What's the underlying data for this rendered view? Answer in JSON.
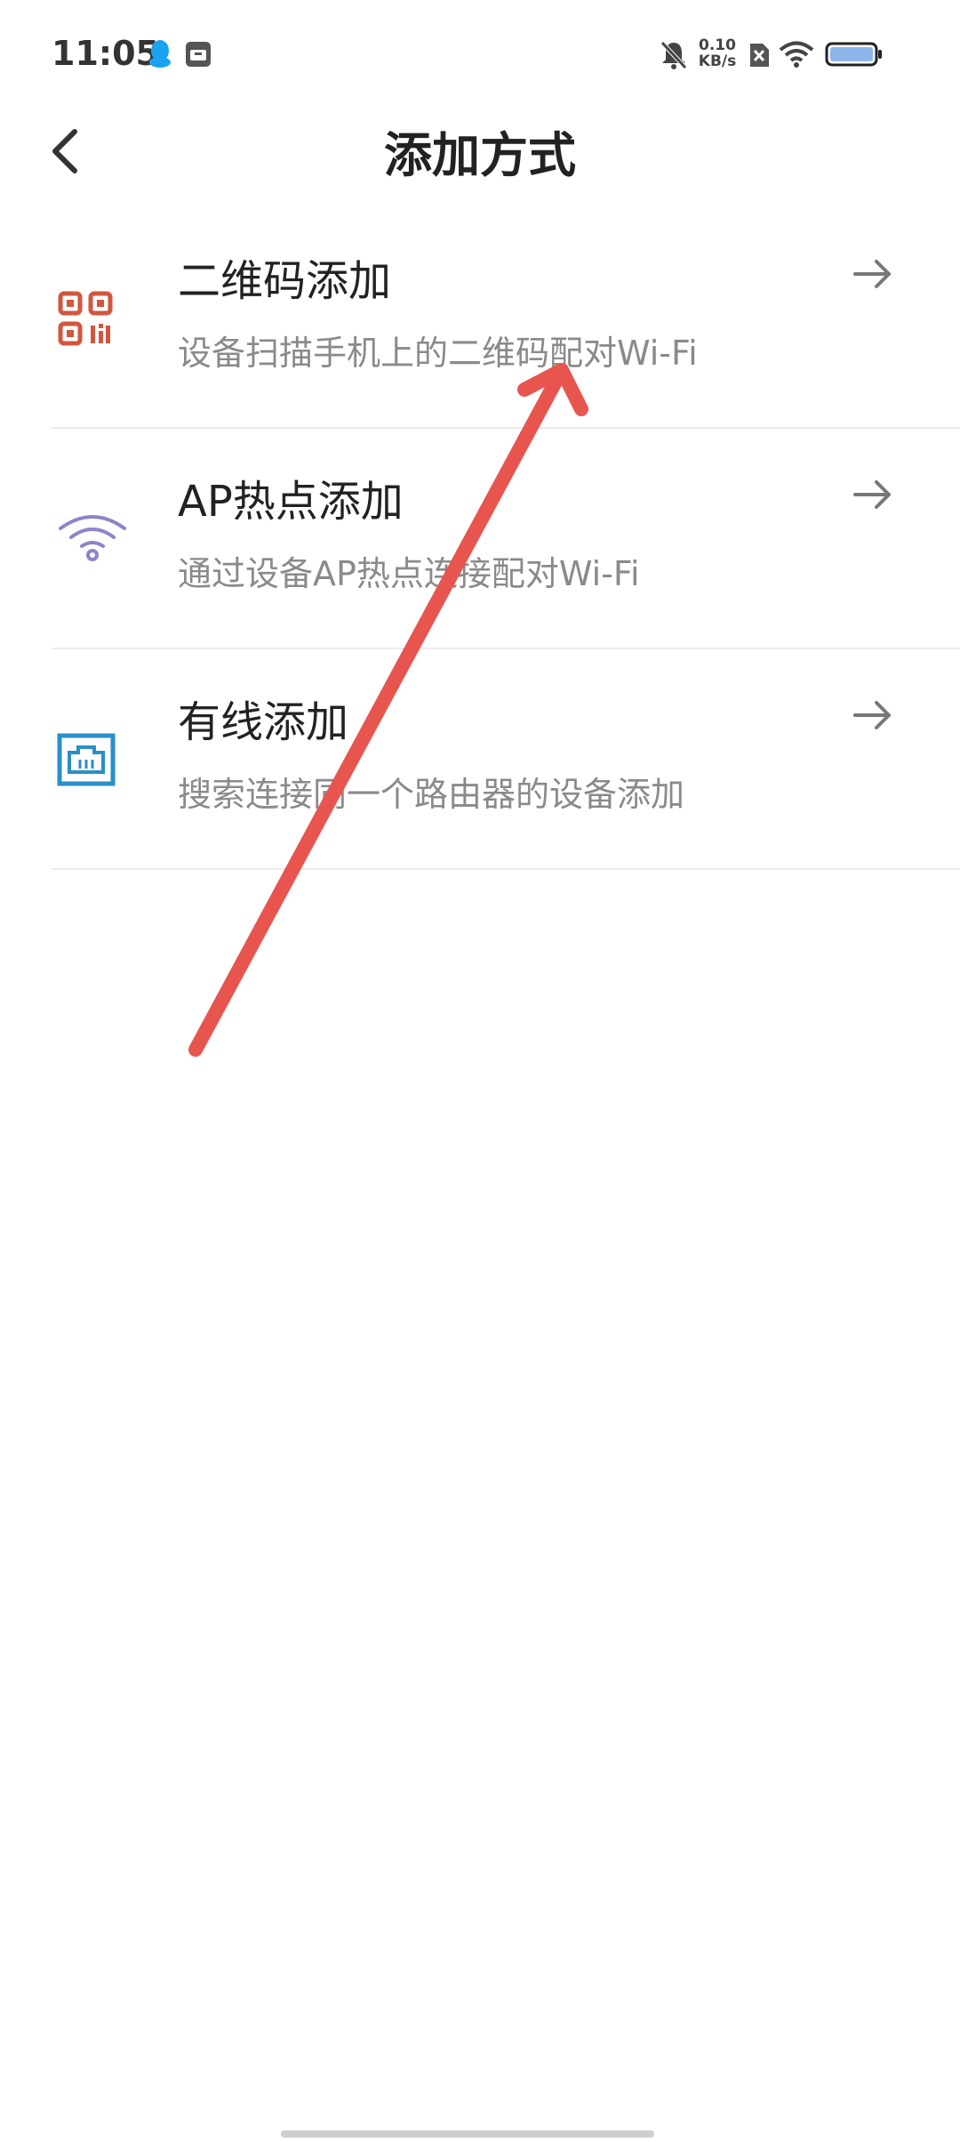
{
  "status_bar": {
    "time": "11:05",
    "net_speed_value": "0.10",
    "net_speed_unit": "KB/s",
    "icons": [
      "qq-icon",
      "calendar-icon",
      "mute-bell-icon",
      "sim-x-icon",
      "wifi-icon",
      "battery-icon"
    ]
  },
  "header": {
    "title": "添加方式",
    "back_icon": "chevron-left-icon"
  },
  "options": [
    {
      "title": "二维码添加",
      "desc": "设备扫描手机上的二维码配对Wi-Fi",
      "icon": "qr-code-icon",
      "icon_color": "#d2563e"
    },
    {
      "title": "AP热点添加",
      "desc": "通过设备AP热点连接配对Wi-Fi",
      "icon": "wifi-hotspot-icon",
      "icon_color": "#8b86c9"
    },
    {
      "title": "有线添加",
      "desc": "搜索连接同一个路由器的设备添加",
      "icon": "ethernet-port-icon",
      "icon_color": "#2a8fc6"
    }
  ],
  "colors": {
    "annotation_arrow": "#e8554f",
    "title_text": "#222222",
    "desc_text": "#8a8a8a",
    "divider": "#ececec"
  }
}
